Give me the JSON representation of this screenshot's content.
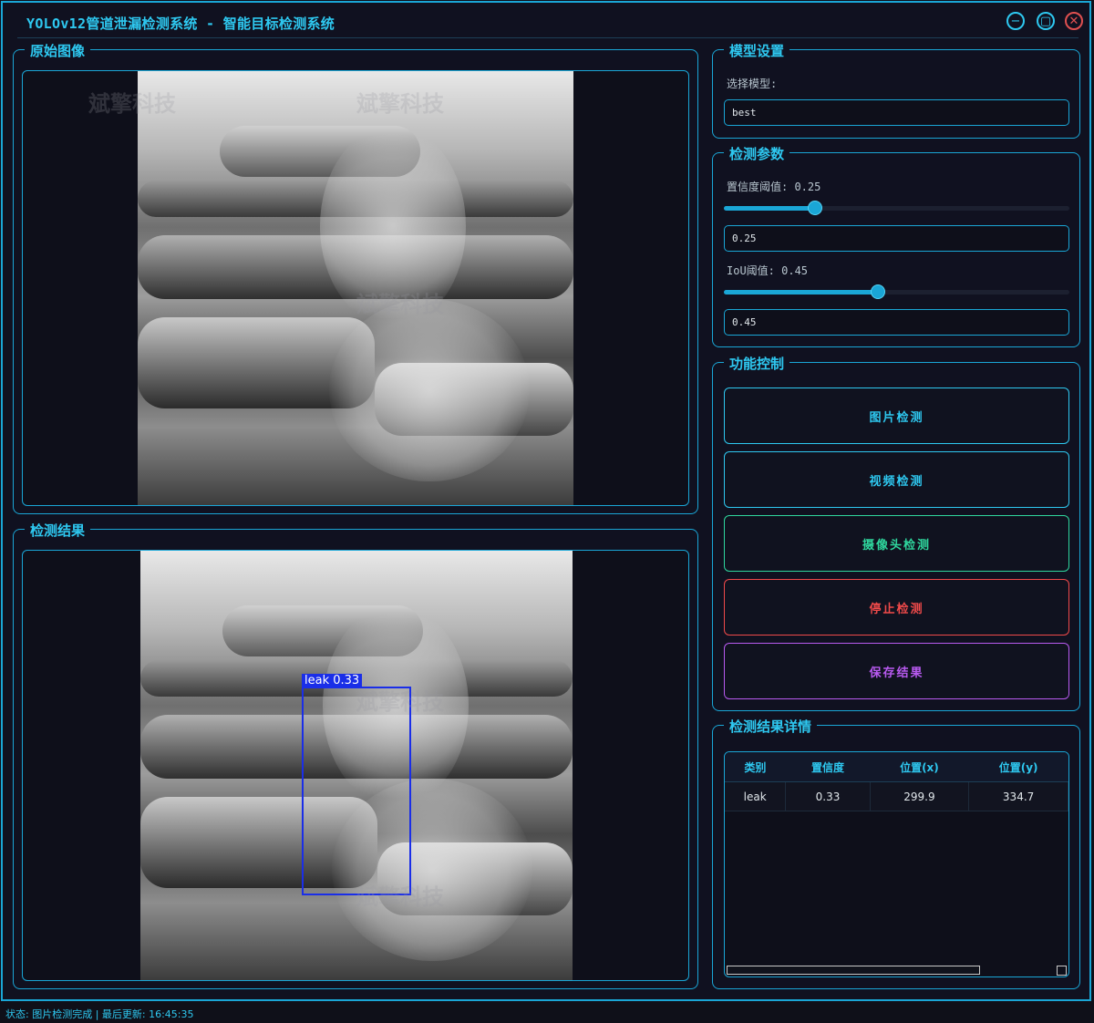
{
  "window": {
    "title": "YOLOv12管道泄漏检测系统 - 智能目标检测系统",
    "minimize_icon": "minimize-icon",
    "maximize_icon": "maximize-icon",
    "close_icon": "close-icon",
    "accent_color": "#1aa6d6"
  },
  "watermark": "斌擎科技",
  "original_panel": {
    "title": "原始图像"
  },
  "result_panel": {
    "title": "检测结果",
    "detection_label": "leak 0.33",
    "box_color": "#1a2ee8"
  },
  "model_settings": {
    "title": "模型设置",
    "select_label": "选择模型:",
    "selected_model": "best"
  },
  "detect_params": {
    "title": "检测参数",
    "confidence_label": "置信度阈值: 0.25",
    "confidence_value": 0.25,
    "confidence_text": "0.25",
    "iou_label": "IoU阈值: 0.45",
    "iou_value": 0.45,
    "iou_text": "0.45"
  },
  "function_control": {
    "title": "功能控制",
    "buttons": [
      {
        "label": "图片检测",
        "color": "#2ec8f0"
      },
      {
        "label": "视频检测",
        "color": "#2ec8f0"
      },
      {
        "label": "摄像头检测",
        "color": "#2fd79e"
      },
      {
        "label": "停止检测",
        "color": "#f04a4a"
      },
      {
        "label": "保存结果",
        "color": "#b85af0"
      }
    ]
  },
  "result_details": {
    "title": "检测结果详情",
    "columns": [
      "类别",
      "置信度",
      "位置(x)",
      "位置(y)"
    ],
    "rows": [
      [
        "leak",
        "0.33",
        "299.9",
        "334.7"
      ]
    ]
  },
  "status_bar": "状态: 图片检测完成 | 最后更新: 16:45:35"
}
